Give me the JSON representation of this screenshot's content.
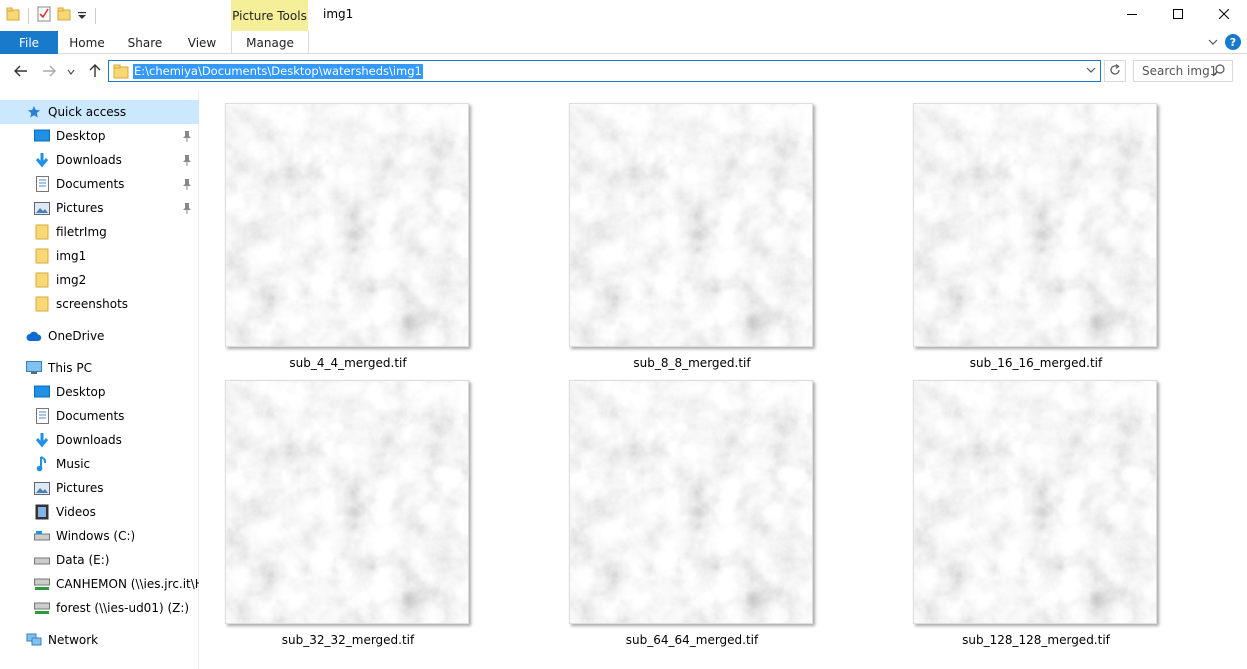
{
  "window": {
    "title": "img1",
    "context_tab_group": "Picture Tools"
  },
  "ribbon": {
    "tabs": [
      {
        "label": "File"
      },
      {
        "label": "Home"
      },
      {
        "label": "Share"
      },
      {
        "label": "View"
      },
      {
        "label": "Manage"
      }
    ]
  },
  "address_bar": {
    "path": "E:\\chemiya\\Documents\\Desktop\\watersheds\\img1"
  },
  "search": {
    "placeholder": "Search img1"
  },
  "sidebar": {
    "quick_access": {
      "label": "Quick access",
      "items": [
        {
          "label": "Desktop",
          "pinned": true
        },
        {
          "label": "Downloads",
          "pinned": true
        },
        {
          "label": "Documents",
          "pinned": true
        },
        {
          "label": "Pictures",
          "pinned": true
        },
        {
          "label": "filetrImg",
          "pinned": false
        },
        {
          "label": "img1",
          "pinned": false
        },
        {
          "label": "img2",
          "pinned": false
        },
        {
          "label": "screenshots",
          "pinned": false
        }
      ]
    },
    "onedrive": {
      "label": "OneDrive"
    },
    "this_pc": {
      "label": "This PC",
      "items": [
        {
          "label": "Desktop"
        },
        {
          "label": "Documents"
        },
        {
          "label": "Downloads"
        },
        {
          "label": "Music"
        },
        {
          "label": "Pictures"
        },
        {
          "label": "Videos"
        },
        {
          "label": "Windows (C:)"
        },
        {
          "label": "Data (E:)"
        },
        {
          "label": "CANHEMON (\\\\ies.jrc.it\\H"
        },
        {
          "label": "forest (\\\\ies-ud01) (Z:)"
        }
      ]
    },
    "network": {
      "label": "Network"
    }
  },
  "files": [
    {
      "name": "sub_4_4_merged.tif"
    },
    {
      "name": "sub_8_8_merged.tif"
    },
    {
      "name": "sub_16_16_merged.tif"
    },
    {
      "name": "sub_32_32_merged.tif"
    },
    {
      "name": "sub_64_64_merged.tif"
    },
    {
      "name": "sub_128_128_merged.tif"
    }
  ],
  "colors": {
    "accent": "#1979ca",
    "context_tab": "#f5ef9a",
    "selection": "#cce8ff",
    "folder": "#f8d775"
  }
}
